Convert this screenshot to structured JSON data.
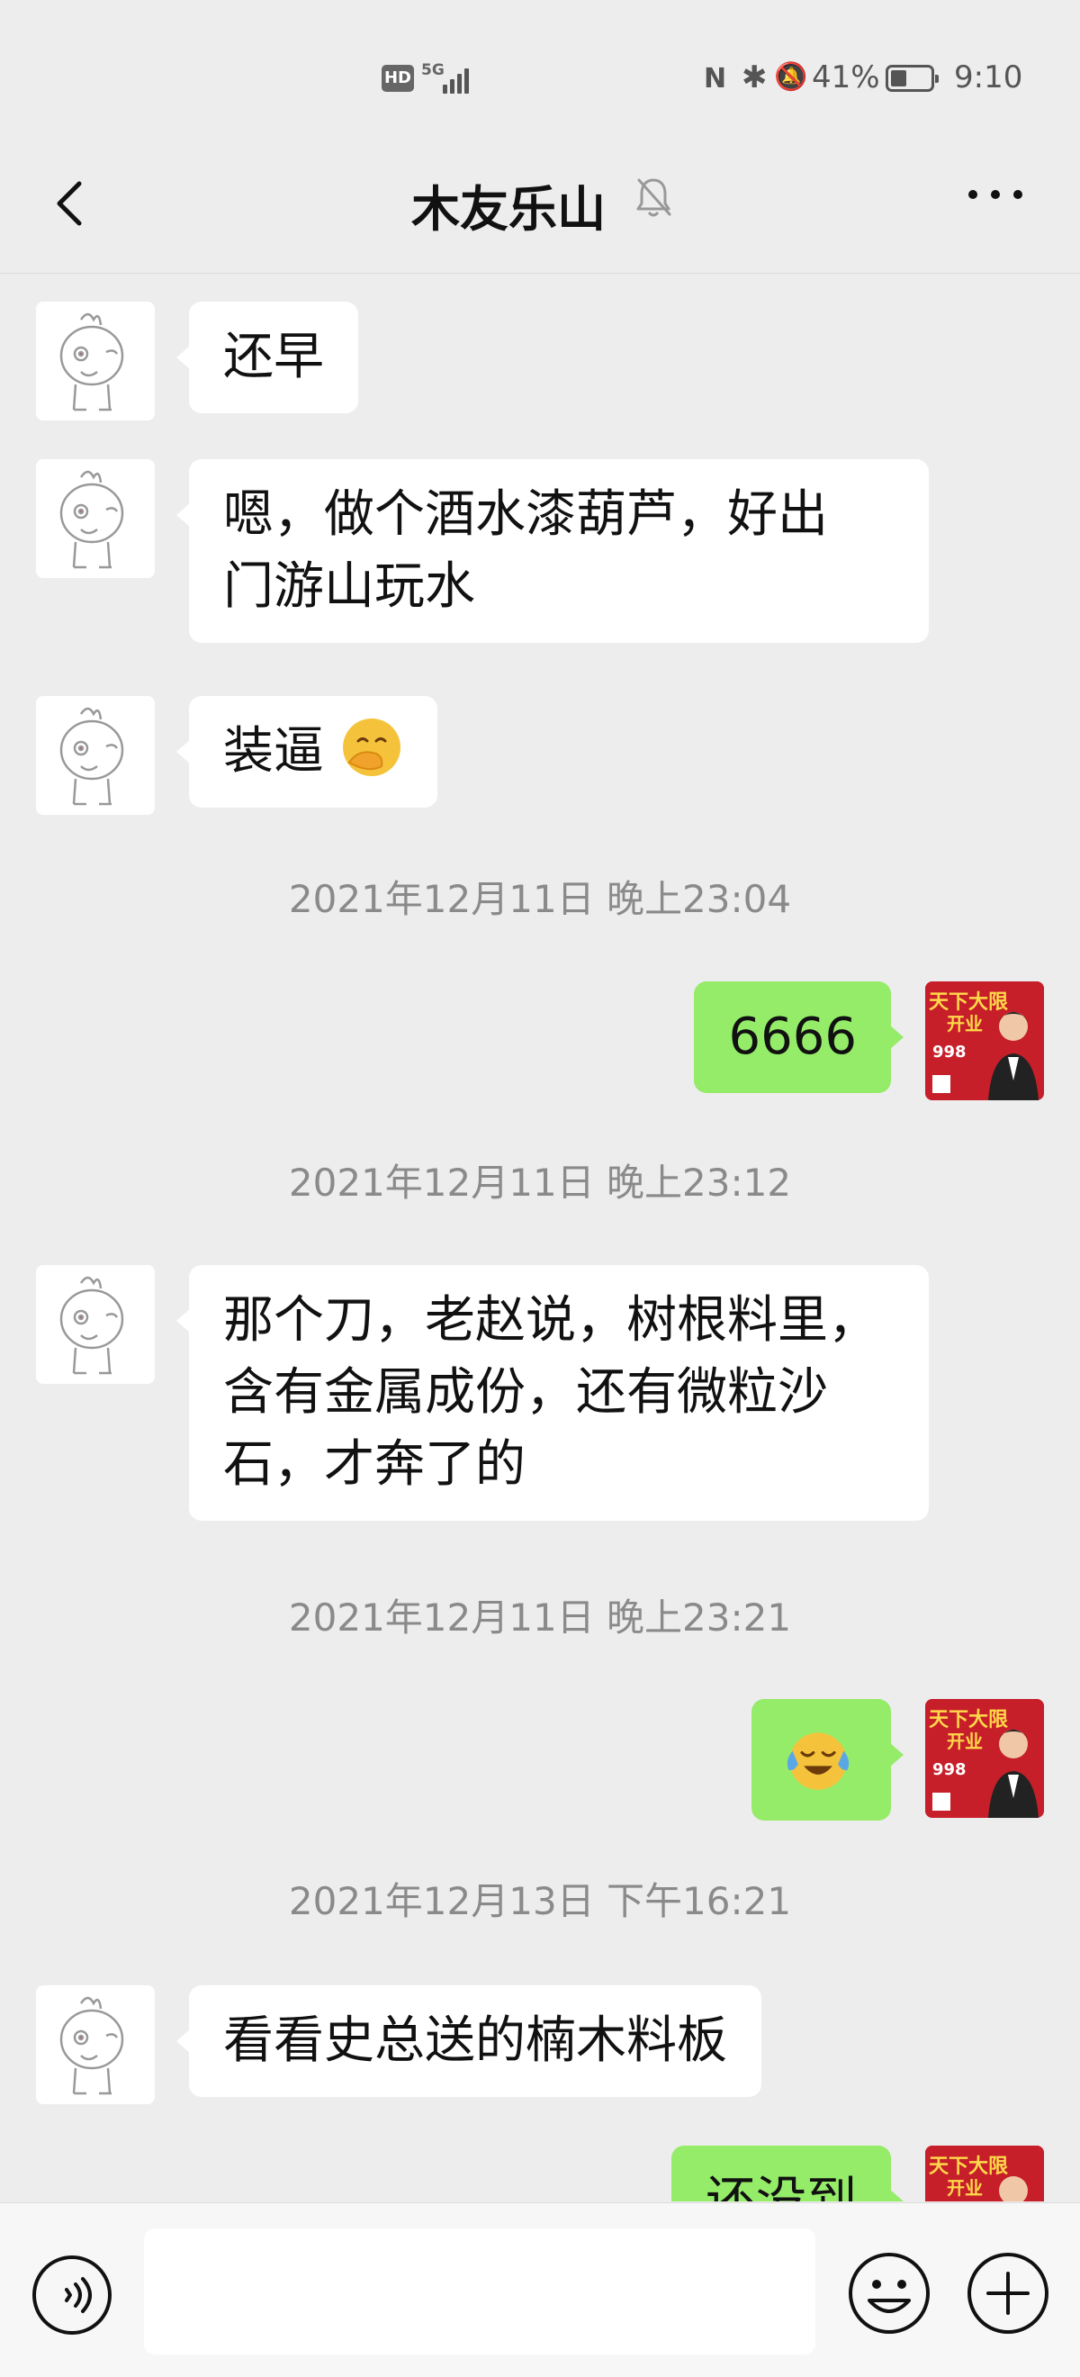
{
  "status_bar": {
    "hd": "HD",
    "network": "5G",
    "nfc": "N",
    "bluetooth": "✱",
    "mute": "🔕",
    "battery_text": "41%",
    "battery_level": 0.41,
    "time": "9:10"
  },
  "header": {
    "title": "木友乐山",
    "icons": [
      "back-icon",
      "mute-bell-icon",
      "more-icon"
    ]
  },
  "messages": [
    {
      "side": "left",
      "text": "还早"
    },
    {
      "side": "left",
      "line1": "嗯，做个酒水漆葫芦，好出",
      "line2": "门游山玩水"
    },
    {
      "side": "left",
      "text": "装逼",
      "emoji": "hand-over-mouth-emoji"
    },
    {
      "timestamp": "2021年12月11日 晚上23:04"
    },
    {
      "side": "right",
      "text": "6666"
    },
    {
      "timestamp": "2021年12月11日 晚上23:12"
    },
    {
      "side": "left",
      "line1": "那个刀，老赵说，树根料里，",
      "line2": "含有金属成份，还有微粒沙",
      "line3": "石，才奔了的"
    },
    {
      "timestamp": "2021年12月11日 晚上23:21"
    },
    {
      "side": "right",
      "emoji": "laughing-crying-emoji"
    },
    {
      "timestamp": "2021年12月13日 下午16:21"
    },
    {
      "side": "left",
      "text": "看看史总送的楠木料板"
    },
    {
      "side": "right",
      "text": "还没到"
    }
  ],
  "avatar_right": {
    "poster_text_1": "天下大限",
    "poster_text_2": "开业",
    "price": "998"
  },
  "input_bar": {
    "value": "",
    "icons": [
      "voice-icon",
      "emoji-icon",
      "plus-icon"
    ]
  },
  "colors": {
    "background": "#ededed",
    "bubble_left": "#ffffff",
    "bubble_right": "#95ec69",
    "timestamp_text": "#8a8a8a"
  }
}
